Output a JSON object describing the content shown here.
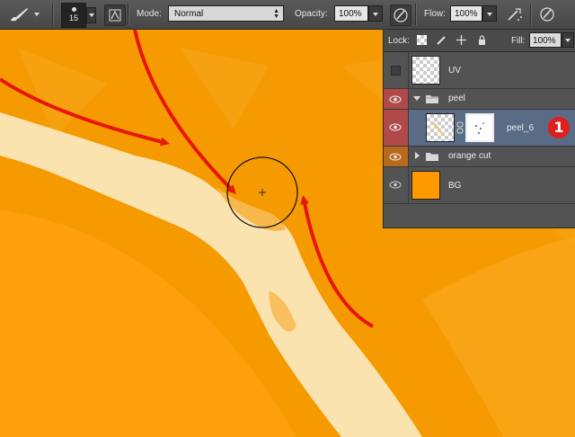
{
  "toolbar": {
    "brush_size": "15",
    "mode_label": "Mode:",
    "mode_value": "Normal",
    "opacity_label": "Opacity:",
    "opacity_value": "100%",
    "flow_label": "Flow:",
    "flow_value": "100%"
  },
  "layers_panel": {
    "lock_label": "Lock:",
    "fill_label": "Fill:",
    "fill_value": "100%",
    "layers": [
      {
        "name": "UV",
        "visible": false,
        "kind": "layer"
      },
      {
        "name": "peel",
        "visible": true,
        "kind": "group",
        "expanded": true
      },
      {
        "name": "peel_6",
        "visible": true,
        "kind": "layer-with-mask",
        "selected": true,
        "annotation": "1"
      },
      {
        "name": "orange cut",
        "visible": true,
        "kind": "group",
        "expanded": false
      },
      {
        "name": "BG",
        "visible": true,
        "kind": "layer",
        "fill_color": "#ff9900"
      }
    ]
  },
  "colors": {
    "orange": "#f59a00",
    "peel": "#fbe4b4",
    "arrow": "#e8150c",
    "selected_layer": "#5a6b85",
    "eye_red": "#b04a4a",
    "eye_orange": "#b86a1c"
  }
}
